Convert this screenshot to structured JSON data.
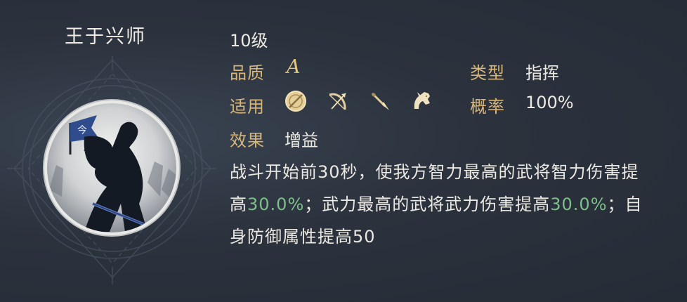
{
  "skill": {
    "name": "王于兴师",
    "level": "10级"
  },
  "fields": {
    "quality_label": "品质",
    "quality_value": "A",
    "type_label": "类型",
    "type_value": "指挥",
    "applicable_label": "适用",
    "applicable_units": [
      "shield-icon",
      "bow-icon",
      "spear-icon",
      "horse-icon"
    ],
    "rate_label": "概率",
    "rate_value": "100%",
    "effect_label": "效果",
    "effect_value": "增益"
  },
  "description": {
    "part1": "战斗开始前30秒，使我方智力最高的武将智力伤害提高",
    "value1": "30.0%",
    "part2": "；武力最高的武将武力伤害提高",
    "value2": "30.0%",
    "part3": "；自身防御属性提高50"
  },
  "colors": {
    "label": "#d8b678",
    "highlight": "#7fbf8b",
    "text": "#ece9e2",
    "background": "#2b323d"
  }
}
